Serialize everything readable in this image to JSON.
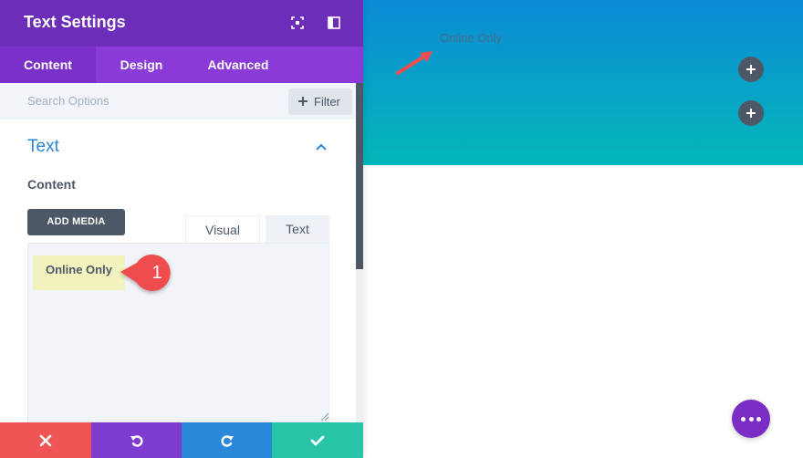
{
  "panel": {
    "title": "Text Settings",
    "header_icons": [
      "expand-icon",
      "sidebar-toggle-icon"
    ],
    "tabs": [
      {
        "label": "Content",
        "active": true
      },
      {
        "label": "Design",
        "active": false
      },
      {
        "label": "Advanced",
        "active": false
      }
    ],
    "search": {
      "placeholder": "Search Options"
    },
    "filter_label": "Filter",
    "section_title": "Text",
    "content_label": "Content",
    "add_media_label": "ADD MEDIA",
    "editor_tabs": [
      "Visual",
      "Text"
    ],
    "editor_content": "Online Only",
    "callout_number": "1",
    "bottom_actions": [
      {
        "icon": "close-icon",
        "color": "#ef5555"
      },
      {
        "icon": "undo-icon",
        "color": "#7e3bd0"
      },
      {
        "icon": "redo-icon",
        "color": "#2b87da"
      },
      {
        "icon": "check-icon",
        "color": "#29c4a9"
      }
    ]
  },
  "canvas": {
    "module_text": "Online Only",
    "gradient_colors": [
      "#0b8bd6",
      "#04b7b9"
    ],
    "add_buttons": [
      "add-row-button",
      "add-section-button"
    ]
  },
  "colors": {
    "header": "#6c2eb9",
    "tabs": "#8a3ad6",
    "accent_blue": "#2b87da",
    "callout_red": "#ef4e4e",
    "fab_purple": "#7a2dc4"
  }
}
